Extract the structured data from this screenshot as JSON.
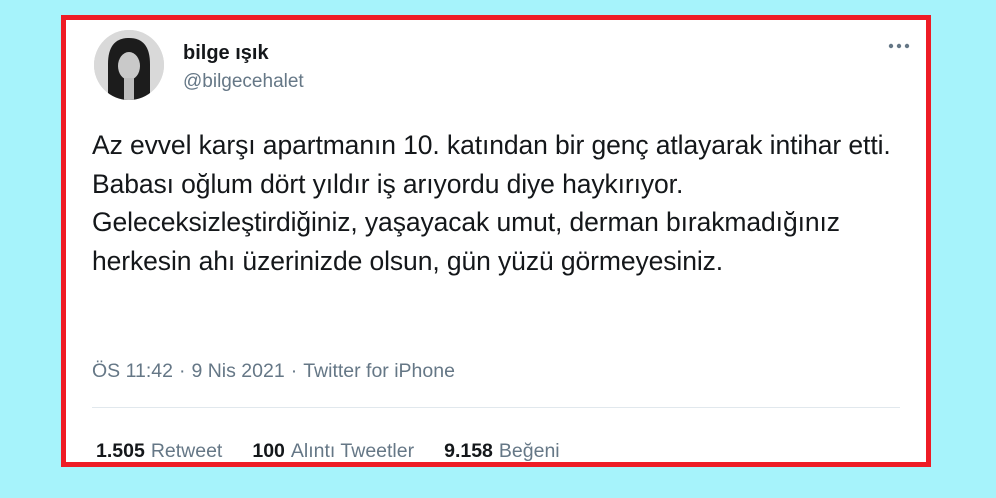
{
  "tweet": {
    "author_name": "bilge ışık",
    "author_handle": "@bilgecehalet",
    "text": "Az evvel karşı apartmanın 10. katından bir genç atlayarak intihar etti. Babası oğlum dört yıldır iş arıyordu diye haykırıyor. Geleceksizleştirdiğiniz, yaşayacak umut, derman bırakmadığınız herkesin ahı üzerinizde olsun, gün yüzü görmeyesiniz.",
    "time": "ÖS 11:42",
    "date": "9 Nis 2021",
    "separator": "·",
    "source": "Twitter for iPhone",
    "more_icon": "more-dots-icon"
  },
  "stats": {
    "retweets": {
      "count": "1.505",
      "label": "Retweet"
    },
    "quotes": {
      "count": "100",
      "label": "Alıntı Tweetler"
    },
    "likes": {
      "count": "9.158",
      "label": "Beğeni"
    }
  },
  "colors": {
    "background": "#a6f3fb",
    "frame": "#ee1c25",
    "text": "#14171a",
    "secondary": "#657786"
  }
}
